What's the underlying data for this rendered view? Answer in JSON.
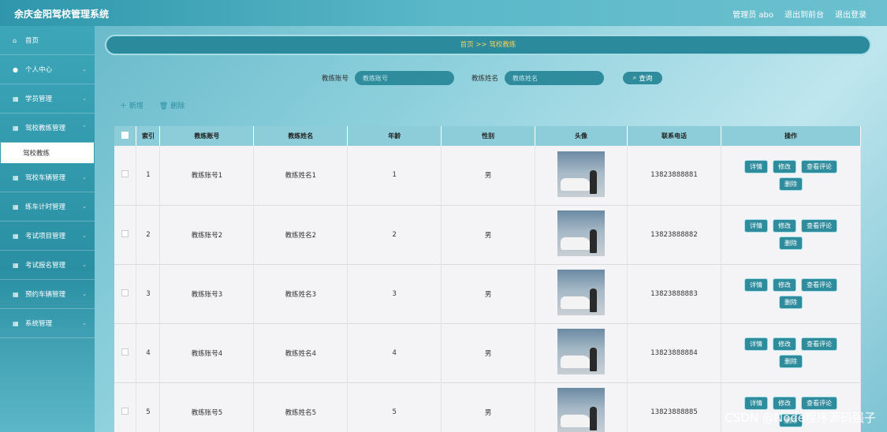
{
  "header": {
    "brand": "余庆金阳驾校管理系统",
    "admin": "管理员 abo",
    "back_front": "退出到前台",
    "logout": "退出登录"
  },
  "sidebar": {
    "items": [
      {
        "label": "首页",
        "icon": "home-icon"
      },
      {
        "label": "个人中心",
        "icon": "user-icon"
      },
      {
        "label": "学员管理",
        "icon": "grid-icon"
      },
      {
        "label": "驾校教练管理",
        "icon": "grid-icon"
      },
      {
        "label": "驾校车辆管理",
        "icon": "grid-icon"
      },
      {
        "label": "练车计时管理",
        "icon": "grid-icon"
      },
      {
        "label": "考试项目管理",
        "icon": "grid-icon"
      },
      {
        "label": "考试报名管理",
        "icon": "grid-icon"
      },
      {
        "label": "预约车辆管理",
        "icon": "grid-icon"
      },
      {
        "label": "系统管理",
        "icon": "grid-icon"
      }
    ],
    "active_sub": "驾校教练"
  },
  "breadcrumb": "首页  >>  驾校教练",
  "search": {
    "label1": "教练账号",
    "placeholder1": "教练账号",
    "label2": "教练姓名",
    "placeholder2": "教练姓名",
    "query": "查询"
  },
  "actions": {
    "add": "新增",
    "delete": "删除"
  },
  "table": {
    "headers": [
      "索引",
      "教练账号",
      "教练姓名",
      "年龄",
      "性别",
      "头像",
      "联系电话",
      "操作"
    ],
    "rows": [
      {
        "index": "1",
        "account": "教练账号1",
        "name": "教练姓名1",
        "age": "1",
        "gender": "男",
        "phone": "13823888881"
      },
      {
        "index": "2",
        "account": "教练账号2",
        "name": "教练姓名2",
        "age": "2",
        "gender": "男",
        "phone": "13823888882"
      },
      {
        "index": "3",
        "account": "教练账号3",
        "name": "教练姓名3",
        "age": "3",
        "gender": "男",
        "phone": "13823888883"
      },
      {
        "index": "4",
        "account": "教练账号4",
        "name": "教练姓名4",
        "age": "4",
        "gender": "男",
        "phone": "13823888884"
      },
      {
        "index": "5",
        "account": "教练账号5",
        "name": "教练姓名5",
        "age": "5",
        "gender": "男",
        "phone": "13823888885"
      }
    ],
    "ops": {
      "detail": "详情",
      "edit": "修改",
      "comments": "查看评论",
      "remove": "删除"
    }
  },
  "watermark": "CSDN @Node程序源码强子",
  "colors": {
    "accent": "#2f8c9c",
    "header": "#8ccdd9",
    "crumb_text": "#f0d060"
  }
}
